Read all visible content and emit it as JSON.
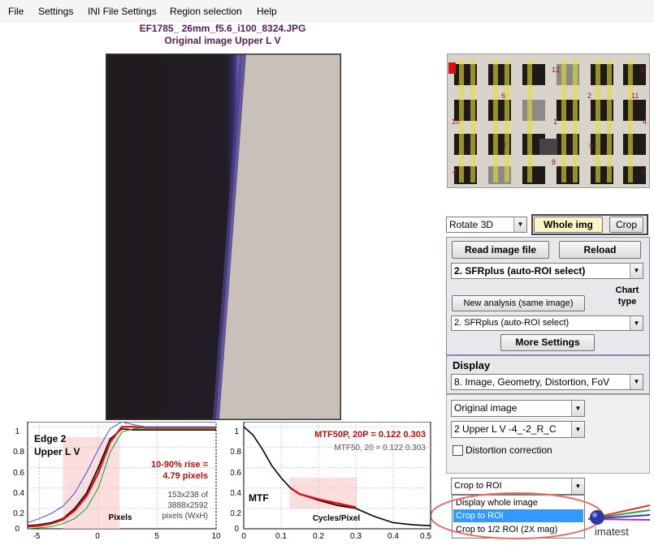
{
  "menu": [
    "File",
    "Settings",
    "INI File Settings",
    "Region selection",
    "Help"
  ],
  "image": {
    "filename": "EF1785_ 26mm_f5.6_i100_8324.JPG",
    "subtitle": "Original image   Upper L V"
  },
  "thumb_labels": [
    "1",
    "12",
    "3",
    "6",
    "2",
    "11",
    "10",
    "1",
    "4",
    "7",
    "9",
    "8",
    "4",
    "5"
  ],
  "controls": {
    "rotate_label": "Rotate 3D",
    "whole_img": "Whole img",
    "crop": "Crop",
    "read_image": "Read image file",
    "reload": "Reload",
    "analysis_select": "2. SFRplus (auto-ROI select)",
    "chart_type_label": "Chart\ntype",
    "new_analysis": "New analysis (same image)",
    "chart_type_select": "2. SFRplus (auto-ROI select)",
    "more_settings": "More Settings",
    "display_label": "Display",
    "display_select": "8.   Image, Geometry, Distortion, FoV",
    "image_select": "Original image",
    "roi_select": "2  Upper L V    -4_-2_R_C",
    "distortion": "Distortion correction",
    "crop_select": "Crop to ROI"
  },
  "dropdown_options": [
    "Display whole image",
    "Crop to ROI",
    "Crop to 1/2 ROI (2X mag)"
  ],
  "dropdown_selected": 1,
  "logo_text": "imatest",
  "edge_plot": {
    "title1": "Edge 2",
    "title2": "Upper L V",
    "rise1": "10-90% rise =",
    "rise2": "4.79 pixels",
    "info1": "153x238 of",
    "info2": "3888x2592",
    "info3": "pixels (WxH)",
    "xlabel": "Pixels",
    "xticks": [
      "-5",
      "0",
      "5",
      "10"
    ],
    "yticks": [
      "1",
      "0.8",
      "0.6",
      "0.4",
      "0.2",
      "0"
    ]
  },
  "mtf_plot": {
    "title": "MTF50P, 20P = 0.122  0.303",
    "sub": "MTF50, 20  =  0.122  0.303",
    "label": "MTF",
    "xlabel": "Cycles/Pixel",
    "xticks": [
      "0",
      "0.1",
      "0.2",
      "0.3",
      "0.4",
      "0.5"
    ],
    "yticks": [
      "1",
      "0.8",
      "0.6",
      "0.4",
      "0.2",
      "0"
    ]
  },
  "chart_data": [
    {
      "type": "line",
      "title": "Edge 2 Upper L V",
      "xlabel": "Pixels",
      "xlim": [
        -6,
        10
      ],
      "ylim": [
        0,
        1.05
      ],
      "series": [
        {
          "name": "black",
          "x": [
            -6,
            -5,
            -4,
            -3,
            -2,
            -1,
            0,
            1,
            2,
            3,
            4,
            6,
            8,
            10
          ],
          "values": [
            0.03,
            0.04,
            0.06,
            0.1,
            0.2,
            0.35,
            0.6,
            0.88,
            0.98,
            0.97,
            0.97,
            0.97,
            0.97,
            0.97
          ]
        },
        {
          "name": "red",
          "x": [
            -6,
            -5,
            -4,
            -3,
            -2,
            -1,
            0,
            1,
            2,
            3,
            4,
            6,
            8,
            10
          ],
          "values": [
            0.02,
            0.03,
            0.05,
            0.09,
            0.18,
            0.32,
            0.55,
            0.85,
            1.0,
            1.0,
            0.99,
            0.99,
            0.99,
            0.99
          ]
        },
        {
          "name": "green",
          "x": [
            -6,
            -5,
            -4,
            -3,
            -2,
            -1,
            0,
            1,
            2,
            3,
            4,
            6,
            8,
            10
          ],
          "values": [
            0.0,
            0.01,
            0.02,
            0.05,
            0.1,
            0.2,
            0.4,
            0.75,
            0.95,
            0.98,
            0.99,
            0.99,
            0.99,
            0.99
          ]
        },
        {
          "name": "blue",
          "x": [
            -6,
            -5,
            -4,
            -3,
            -2,
            -1,
            0,
            1,
            2,
            3,
            4,
            6,
            8,
            10
          ],
          "values": [
            0.06,
            0.1,
            0.15,
            0.22,
            0.35,
            0.55,
            0.78,
            0.98,
            1.05,
            1.02,
            1.0,
            1.0,
            1.0,
            1.0
          ]
        }
      ]
    },
    {
      "type": "line",
      "title": "MTF50P, 20P = 0.122  0.303",
      "xlabel": "Cycles/Pixel",
      "xlim": [
        0,
        0.5
      ],
      "ylim": [
        0,
        1.05
      ],
      "series": [
        {
          "name": "black",
          "x": [
            0,
            0.025,
            0.05,
            0.075,
            0.1,
            0.125,
            0.15,
            0.2,
            0.25,
            0.3,
            0.35,
            0.4,
            0.45,
            0.5
          ],
          "values": [
            1.0,
            0.92,
            0.78,
            0.62,
            0.5,
            0.4,
            0.34,
            0.28,
            0.23,
            0.2,
            0.12,
            0.06,
            0.04,
            0.03
          ]
        },
        {
          "name": "red",
          "x": [
            0.125,
            0.15,
            0.2,
            0.25,
            0.3
          ],
          "values": [
            0.4,
            0.34,
            0.29,
            0.25,
            0.21
          ]
        }
      ]
    }
  ]
}
